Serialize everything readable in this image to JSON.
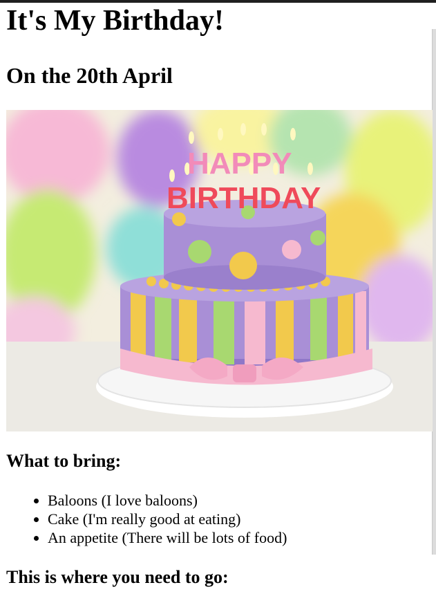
{
  "heading": "It's My Birthday!",
  "subheading": "On the 20th April",
  "image": {
    "topper_line1": "HAPPY",
    "topper_line2": "BIRTHDAY"
  },
  "bring": {
    "title": "What to bring:",
    "items": [
      "Baloons (I love baloons)",
      "Cake (I'm really good at eating)",
      "An appetite (There will be lots of food)"
    ]
  },
  "location": {
    "title": "This is where you need to go:"
  },
  "colors": {
    "cake_purple": "#a98fd6",
    "cake_yellow": "#f2c94c",
    "cake_green": "#a8d870",
    "ribbon_pink": "#f6b9cf"
  }
}
